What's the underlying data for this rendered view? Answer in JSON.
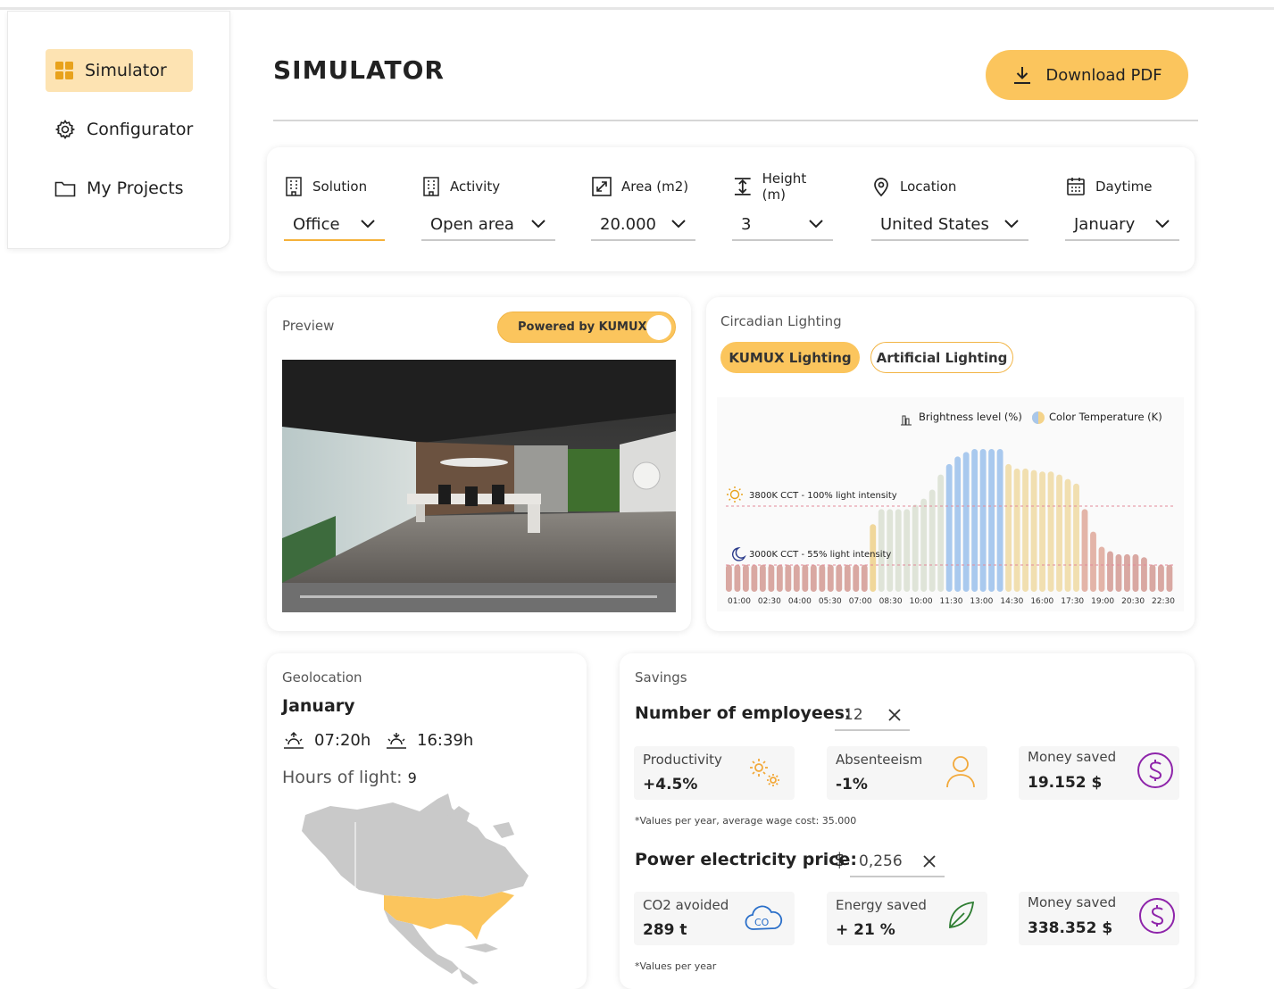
{
  "sidebar": {
    "items": [
      {
        "label": "Simulator",
        "icon": "grid-icon",
        "active": true
      },
      {
        "label": "Configurator",
        "icon": "gear-icon",
        "active": false
      },
      {
        "label": "My Projects",
        "icon": "folder-icon",
        "active": false
      }
    ]
  },
  "header": {
    "title": "SIMULATOR",
    "download_label": "Download PDF"
  },
  "filters": [
    {
      "label": "Solution",
      "value": "Office",
      "icon": "building-icon"
    },
    {
      "label": "Activity",
      "value": "Open area",
      "icon": "building-icon"
    },
    {
      "label": "Area (m2)",
      "value": "20.000",
      "icon": "expand-icon"
    },
    {
      "label": "Height (m)",
      "value": "3",
      "icon": "height-icon"
    },
    {
      "label": "Location",
      "value": "United States",
      "icon": "location-pin-icon"
    },
    {
      "label": "Daytime",
      "value": "January",
      "icon": "calendar-icon"
    }
  ],
  "preview": {
    "label": "Preview",
    "toggle_label": "Powered by KUMUX",
    "toggle_on": true
  },
  "circadian": {
    "label": "Circadian Lighting",
    "tabs": [
      "KUMUX Lighting",
      "Artificial Lighting"
    ],
    "legend": {
      "brightness": "Brightness level (%)",
      "color_temp": "Color Temperature (K)"
    },
    "ref_high": "3800K CCT - 100% light intensity",
    "ref_low": "3000K CCT - 55% light intensity"
  },
  "chart_data": {
    "type": "bar",
    "x_ticks": [
      "01:00",
      "02:30",
      "04:00",
      "05:30",
      "07:00",
      "08:30",
      "10:00",
      "11:30",
      "13:00",
      "14:30",
      "16:00",
      "17:30",
      "19:00",
      "20:30",
      "22:30"
    ],
    "series": [
      {
        "name": "Brightness level (%)",
        "values": [
          18,
          18,
          18,
          18,
          18,
          18,
          18,
          18,
          18,
          18,
          18,
          18,
          18,
          18,
          18,
          18,
          18,
          45,
          55,
          55,
          55,
          55,
          58,
          62,
          68,
          78,
          85,
          90,
          93,
          95,
          95,
          95,
          95,
          85,
          82,
          82,
          81,
          80,
          80,
          78,
          75,
          72,
          55,
          40,
          30,
          27,
          25,
          25,
          25,
          23,
          18,
          18,
          18
        ]
      }
    ],
    "reference_lines": [
      {
        "label": "3800K CCT - 100% light intensity",
        "y": 55
      },
      {
        "label": "3000K CCT - 55% light intensity",
        "y": 18
      }
    ],
    "grid": false,
    "legend": "top-right"
  },
  "geolocation": {
    "label": "Geolocation",
    "month": "January",
    "sunrise": "07:20h",
    "sunset": "16:39h",
    "hours_label": "Hours of light:",
    "hours_value": "9"
  },
  "savings": {
    "label": "Savings",
    "employees_label": "Number of employees:",
    "employees_value": "12",
    "metrics_top": [
      {
        "label": "Productivity",
        "value": "+4.5%",
        "icon": "gears-icon",
        "color": "#f2a93b"
      },
      {
        "label": "Absenteeism",
        "value": "-1%",
        "icon": "person-icon",
        "color": "#f2a93b"
      },
      {
        "label": "Money saved",
        "value": "19.152 $",
        "icon": "dollar-icon",
        "color": "#8e24aa"
      }
    ],
    "note_top": "*Values per year, average wage cost: 35.000",
    "price_label": "Power electricity price:",
    "price_currency": "$",
    "price_value": "0,256",
    "metrics_bottom": [
      {
        "label": "CO2 avoided",
        "value": "289 t",
        "icon": "co2-cloud-icon",
        "color": "#2a6fc9"
      },
      {
        "label": "Energy saved",
        "value": "+ 21 %",
        "icon": "leaf-icon",
        "color": "#2e7d32"
      },
      {
        "label": "Money saved",
        "value": "338.352 $",
        "icon": "dollar-icon",
        "color": "#8e24aa"
      }
    ],
    "note_bottom": "*Values per year"
  }
}
